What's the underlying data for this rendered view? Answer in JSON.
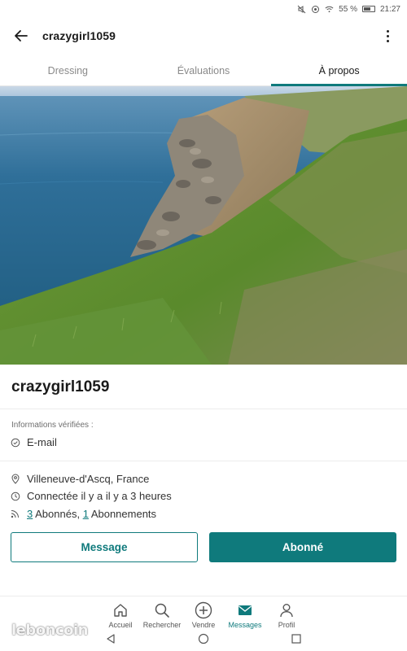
{
  "status_bar": {
    "battery_percent": "55 %",
    "time": "21:27",
    "icons": [
      "mute-icon",
      "do-not-disturb-icon",
      "wifi-icon",
      "battery-icon"
    ]
  },
  "header": {
    "back_icon": "arrow-left-icon",
    "title": "crazygirl1059",
    "more_icon": "more-vertical-icon"
  },
  "tabs": [
    {
      "label": "Dressing",
      "active": false
    },
    {
      "label": "Évaluations",
      "active": false
    },
    {
      "label": "À propos",
      "active": true
    }
  ],
  "hero_image": {
    "description_icon": "coastal-cliff-photo"
  },
  "profile": {
    "username": "crazygirl1059",
    "verified_label": "Informations vérifiées :",
    "verified_items": [
      {
        "icon": "check-circle-icon",
        "label": "E-mail"
      }
    ],
    "location": {
      "icon": "location-pin-icon",
      "text": "Villeneuve-d'Ascq, France"
    },
    "last_seen": {
      "icon": "clock-icon",
      "text": "Connectée il y a il y a 3 heures"
    },
    "followers": {
      "icon": "rss-icon",
      "followers_count": "3",
      "followers_label": " Abonnés, ",
      "following_count": "1",
      "following_label": " Abonnements"
    }
  },
  "actions": {
    "message_label": "Message",
    "follow_label": "Abonné"
  },
  "bottom_nav": [
    {
      "label": "Accueil",
      "icon": "home-icon",
      "active": false
    },
    {
      "label": "Rechercher",
      "icon": "search-icon",
      "active": false
    },
    {
      "label": "Vendre",
      "icon": "plus-circle-icon",
      "active": false
    },
    {
      "label": "Messages",
      "icon": "envelope-icon",
      "active": true
    },
    {
      "label": "Profil",
      "icon": "user-icon",
      "active": false
    }
  ],
  "system_nav": [
    "back-triangle-icon",
    "home-circle-icon",
    "recents-square-icon"
  ],
  "watermark": "leboncoin",
  "colors": {
    "accent": "#0f7a7c",
    "text": "#1a1a1a",
    "muted": "#8a8a8a"
  }
}
